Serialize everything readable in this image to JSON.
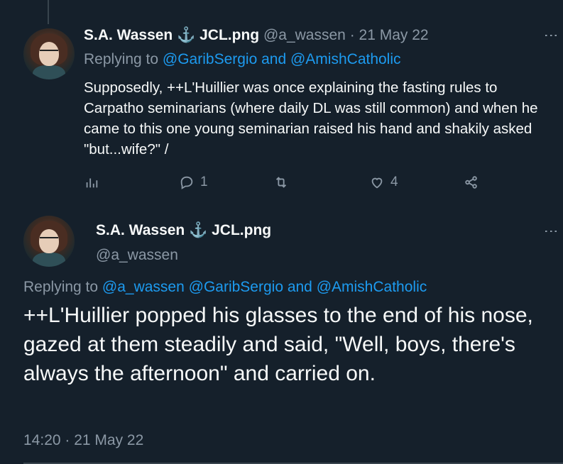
{
  "tweet1": {
    "name": "S.A. Wassen",
    "anchor": "⚓",
    "name_suffix": "JCL.png",
    "handle": "@a_wassen",
    "dot": "·",
    "date": "21 May 22",
    "replying_prefix": "Replying to",
    "replying_to": "@GaribSergio and @AmishCatholic",
    "body": "Supposedly, ++L'Huillier was once explaining the fasting rules to Carpatho seminarians (where daily DL was still common) and when he came to this one young seminarian raised his hand and shakily asked \"but...wife?\" /",
    "replies": "1",
    "retweets": "",
    "likes": "4",
    "more": "⋮",
    "icons": [
      "analytics-icon",
      "reply-icon",
      "retweet-icon",
      "like-icon",
      "share-icon"
    ]
  },
  "tweet2": {
    "name": "S.A. Wassen",
    "anchor": "⚓",
    "name_suffix": "JCL.png",
    "handle": "@a_wassen",
    "more": "⋮",
    "replying_prefix": "Replying to",
    "replying_to": "@a_wassen @GaribSergio and @AmishCatholic",
    "body": "++L'Huillier popped his glasses to the end of his nose, gazed at them steadily and said, \"Well, boys, there's always the afternoon\" and carried on.",
    "timestamp": "14:20 · 21 May 22"
  },
  "colors": {
    "background": "#15202b",
    "text": "#f7f9f9",
    "secondary": "#8b98a5",
    "accent": "#1d9bf0"
  }
}
